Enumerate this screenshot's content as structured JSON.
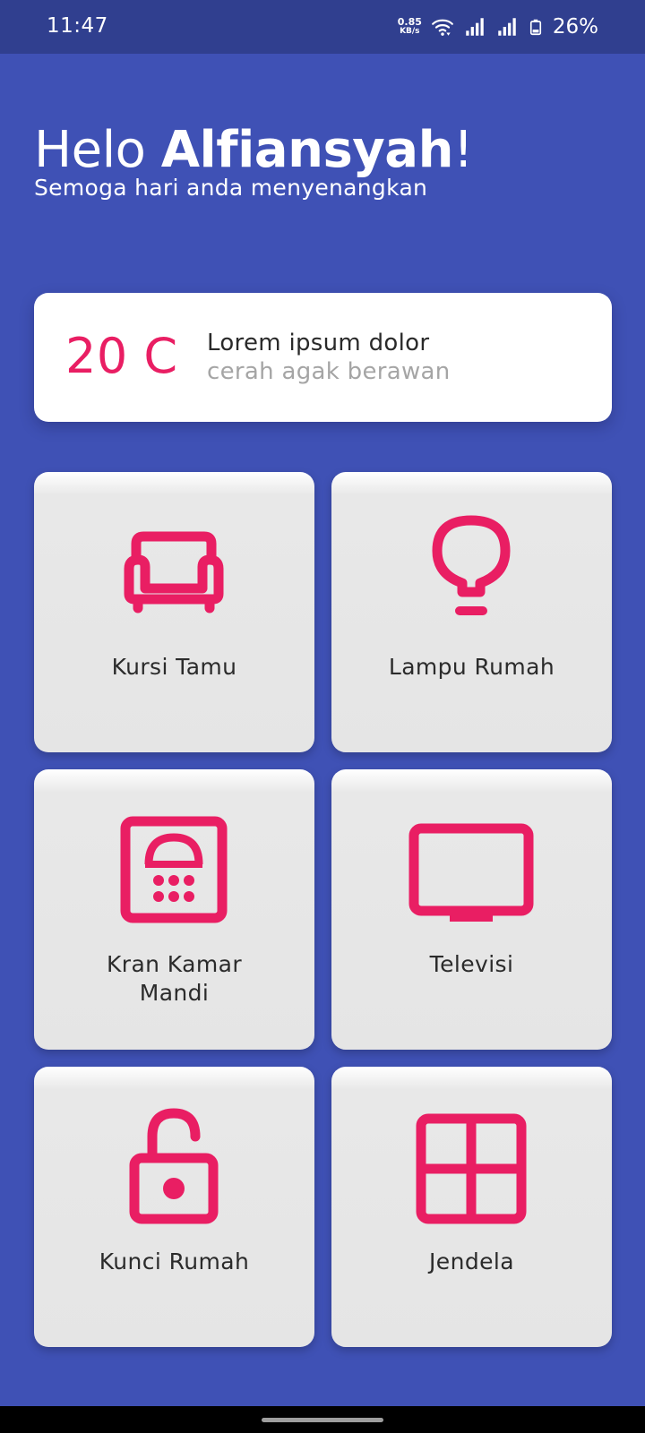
{
  "status_bar": {
    "time": "11:47",
    "net_speed_value": "0.85",
    "net_speed_unit": "KB/s",
    "battery_percent": "26%"
  },
  "greeting": {
    "hello": "Helo",
    "name": "Alfiansyah",
    "exclaim": "!",
    "subtitle": "Semoga hari anda menyenangkan"
  },
  "weather": {
    "temperature": "20 C",
    "title": "Lorem ipsum dolor",
    "description": "cerah agak berawan"
  },
  "devices": [
    {
      "label": "Kursi Tamu",
      "icon": "sofa-icon"
    },
    {
      "label": "Lampu Rumah",
      "icon": "lightbulb-icon"
    },
    {
      "label": "Kran Kamar Mandi",
      "icon": "shower-icon"
    },
    {
      "label": "Televisi",
      "icon": "tv-icon"
    },
    {
      "label": "Kunci Rumah",
      "icon": "unlock-icon"
    },
    {
      "label": "Jendela",
      "icon": "window-icon"
    }
  ],
  "colors": {
    "background": "#3F51B5",
    "status_bar": "#303F8F",
    "accent": "#E91E63",
    "card": "#FFFFFF",
    "tile": "#E5E5E5"
  }
}
